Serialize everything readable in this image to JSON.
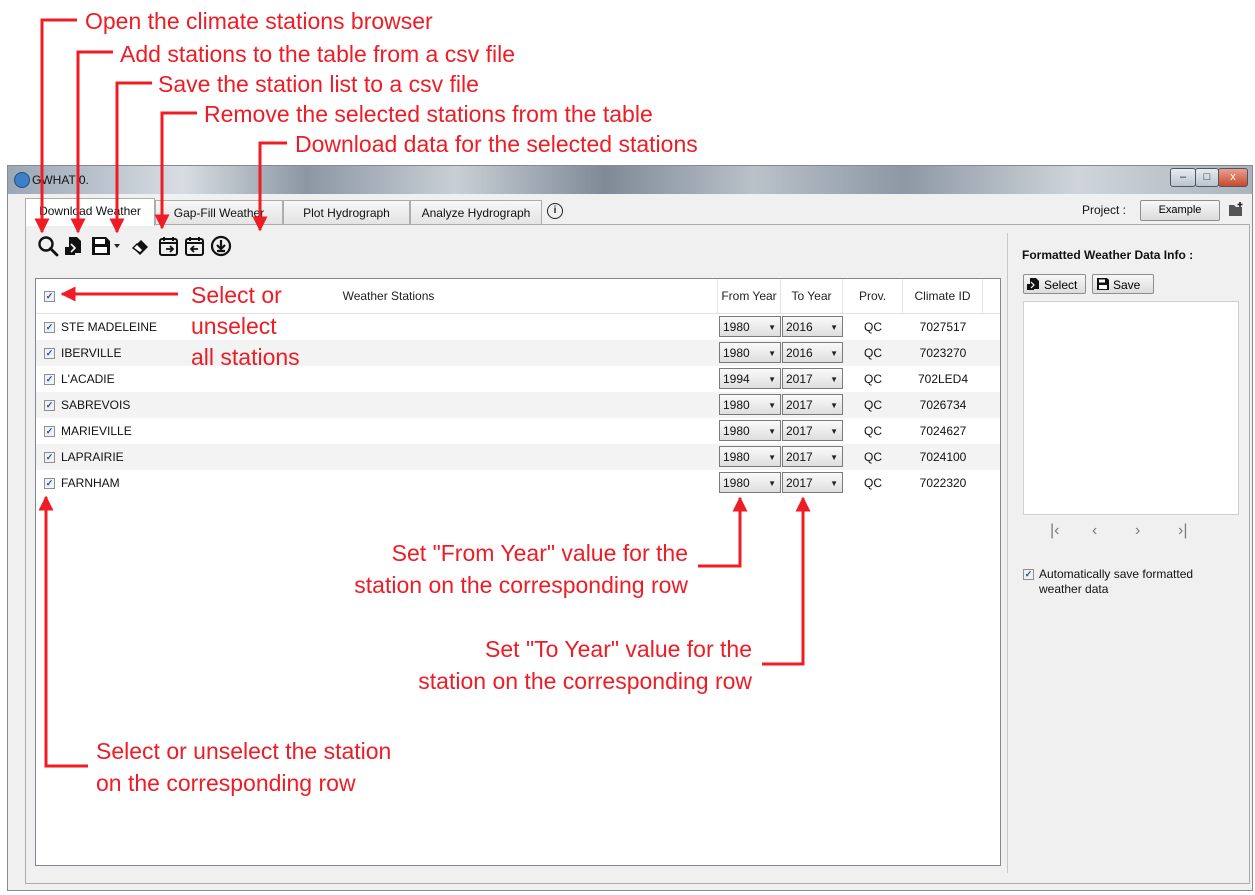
{
  "annotations": {
    "open_browser": "Open the climate stations browser",
    "add_csv": "Add stations to the table from a csv file",
    "save_csv": "Save the station list to a csv file",
    "remove_selected": "Remove the selected stations from the table",
    "download": "Download data for the selected stations",
    "select_all_1": "Select or",
    "select_all_2": "unselect",
    "select_all_3": "all stations",
    "from_year_1": "Set \"From Year\" value for the",
    "from_year_2": "station on the corresponding row",
    "to_year_1": "Set \"To Year\" value for the",
    "to_year_2": "station on the corresponding row",
    "row_select_1": "Select or unselect the station",
    "row_select_2": "on the corresponding row"
  },
  "window": {
    "title": "GWHAT 0.",
    "min": "–",
    "max": "□",
    "close": "x"
  },
  "tabs": [
    {
      "label": "Download Weather",
      "active": true
    },
    {
      "label": "Gap-Fill Weather",
      "active": false
    },
    {
      "label": "Plot Hydrograph",
      "active": false
    },
    {
      "label": "Analyze Hydrograph",
      "active": false
    }
  ],
  "info_icon": "i",
  "project": {
    "label": "Project :",
    "button": "Example"
  },
  "toolbar_icons": [
    "search-icon",
    "import-csv-icon",
    "save-icon",
    "eraser-icon",
    "calendar-from-icon",
    "calendar-to-icon",
    "download-icon"
  ],
  "table": {
    "headers": {
      "station": "Weather Stations",
      "from": "From Year",
      "to": "To Year",
      "prov": "Prov.",
      "climate_id": "Climate ID"
    },
    "rows": [
      {
        "station": "STE MADELEINE",
        "from": "1980",
        "to": "2016",
        "prov": "QC",
        "climate_id": "7027517"
      },
      {
        "station": "IBERVILLE",
        "from": "1980",
        "to": "2016",
        "prov": "QC",
        "climate_id": "7023270"
      },
      {
        "station": "L'ACADIE",
        "from": "1994",
        "to": "2017",
        "prov": "QC",
        "climate_id": "702LED4"
      },
      {
        "station": "SABREVOIS",
        "from": "1980",
        "to": "2017",
        "prov": "QC",
        "climate_id": "7026734"
      },
      {
        "station": "MARIEVILLE",
        "from": "1980",
        "to": "2017",
        "prov": "QC",
        "climate_id": "7024627"
      },
      {
        "station": "LAPRAIRIE",
        "from": "1980",
        "to": "2017",
        "prov": "QC",
        "climate_id": "7024100"
      },
      {
        "station": "FARNHAM",
        "from": "1980",
        "to": "2017",
        "prov": "QC",
        "climate_id": "7022320"
      }
    ]
  },
  "right_panel": {
    "title": "Formatted Weather Data Info :",
    "select": "Select",
    "save": "Save",
    "nav": [
      "|‹",
      "‹",
      "›",
      "›|"
    ],
    "auto_save": "Automatically save formatted weather data"
  },
  "colors": {
    "annotation": "#ee1c25",
    "check": "#2c4e86"
  }
}
